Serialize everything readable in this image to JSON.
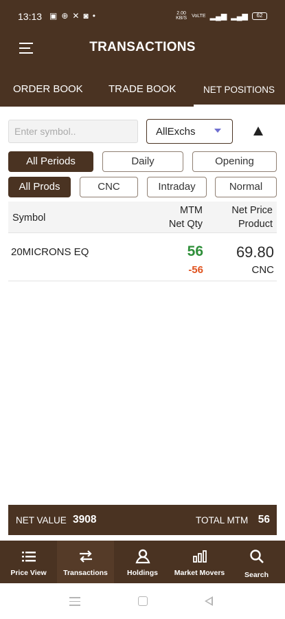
{
  "status_bar": {
    "time": "13:13",
    "battery": "62",
    "network_speed": "2.00 KB/S",
    "network_type": "VoLTE"
  },
  "header": {
    "title": "TRANSACTIONS"
  },
  "tabs": [
    {
      "label": "ORDER BOOK"
    },
    {
      "label": "TRADE BOOK"
    },
    {
      "label": "NET POSITIONS",
      "active": true
    }
  ],
  "filters": {
    "symbol_placeholder": "Enter symbol..",
    "exchange_selected": "AllExchs",
    "periods": [
      {
        "label": "All Periods",
        "active": true
      },
      {
        "label": "Daily"
      },
      {
        "label": "Opening"
      }
    ],
    "products": [
      {
        "label": "All Prods",
        "active": true
      },
      {
        "label": "CNC"
      },
      {
        "label": "Intraday"
      },
      {
        "label": "Normal"
      }
    ]
  },
  "table": {
    "headers": {
      "symbol": "Symbol",
      "mtm": "MTM",
      "net_qty": "Net Qty",
      "net_price": "Net Price",
      "product": "Product"
    },
    "rows": [
      {
        "symbol": "20MICRONS EQ",
        "mtm": "56",
        "net_qty": "-56",
        "net_price": "69.80",
        "product": "CNC"
      }
    ]
  },
  "summary": {
    "net_value_label": "NET VALUE",
    "net_value": "3908",
    "total_mtm_label": "TOTAL MTM",
    "total_mtm": "56"
  },
  "bottom_nav": [
    {
      "label": "Price View",
      "icon": "list-icon"
    },
    {
      "label": "Transactions",
      "icon": "swap-arrows-icon",
      "active": true
    },
    {
      "label": "Holdings",
      "icon": "holdings-icon"
    },
    {
      "label": "Market Movers",
      "icon": "bar-chart-icon"
    },
    {
      "label": "Search",
      "icon": "search-icon"
    }
  ],
  "colors": {
    "brand_brown": "#4a3322",
    "mtm_positive": "#2f8f3a",
    "qty_negative": "#e0531f"
  }
}
